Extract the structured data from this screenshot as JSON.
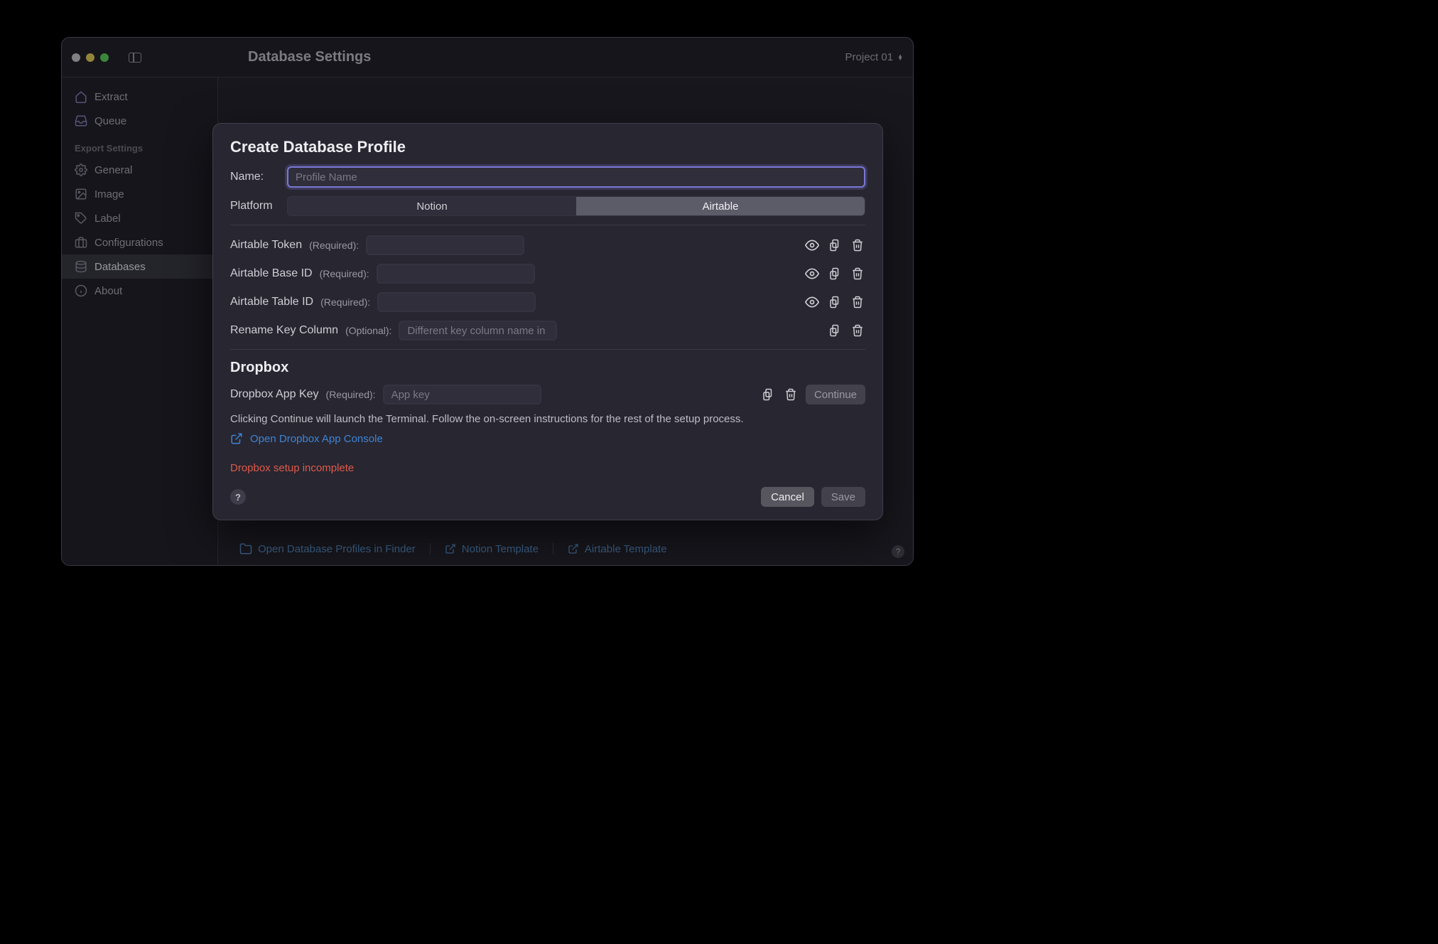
{
  "window": {
    "title": "Database Settings",
    "project": "Project 01"
  },
  "sidebar": {
    "items_top": [
      {
        "icon": "home",
        "label": "Extract"
      },
      {
        "icon": "tray",
        "label": "Queue"
      }
    ],
    "section_header": "Export Settings",
    "items": [
      {
        "icon": "gear",
        "label": "General"
      },
      {
        "icon": "image",
        "label": "Image"
      },
      {
        "icon": "tag",
        "label": "Label"
      },
      {
        "icon": "briefcase",
        "label": "Configurations"
      },
      {
        "icon": "database",
        "label": "Databases"
      },
      {
        "icon": "info",
        "label": "About"
      }
    ]
  },
  "bottom_links": {
    "open_profiles": "Open Database Profiles in Finder",
    "notion_template": "Notion Template",
    "airtable_template": "Airtable Template"
  },
  "modal": {
    "title": "Create Database Profile",
    "name_label": "Name:",
    "name_placeholder": "Profile Name",
    "platform_label": "Platform",
    "platform_options": {
      "notion": "Notion",
      "airtable": "Airtable"
    },
    "fields": {
      "token": {
        "label": "Airtable Token",
        "req": "(Required):"
      },
      "base": {
        "label": "Airtable Base ID",
        "req": "(Required):"
      },
      "table": {
        "label": "Airtable Table ID",
        "req": "(Required):"
      },
      "rename": {
        "label": "Rename Key Column",
        "req": "(Optional):",
        "placeholder": "Different key column name in Notion (Default is \"Marker ID\")"
      }
    },
    "dropbox": {
      "heading": "Dropbox",
      "appkey_label": "Dropbox App Key",
      "appkey_req": "(Required):",
      "appkey_placeholder": "App key",
      "continue": "Continue",
      "hint": "Clicking Continue will launch the Terminal. Follow the on-screen instructions for the rest of the setup process.",
      "open_console": "Open Dropbox App Console",
      "error": "Dropbox setup incomplete"
    },
    "footer": {
      "cancel": "Cancel",
      "save": "Save"
    }
  }
}
